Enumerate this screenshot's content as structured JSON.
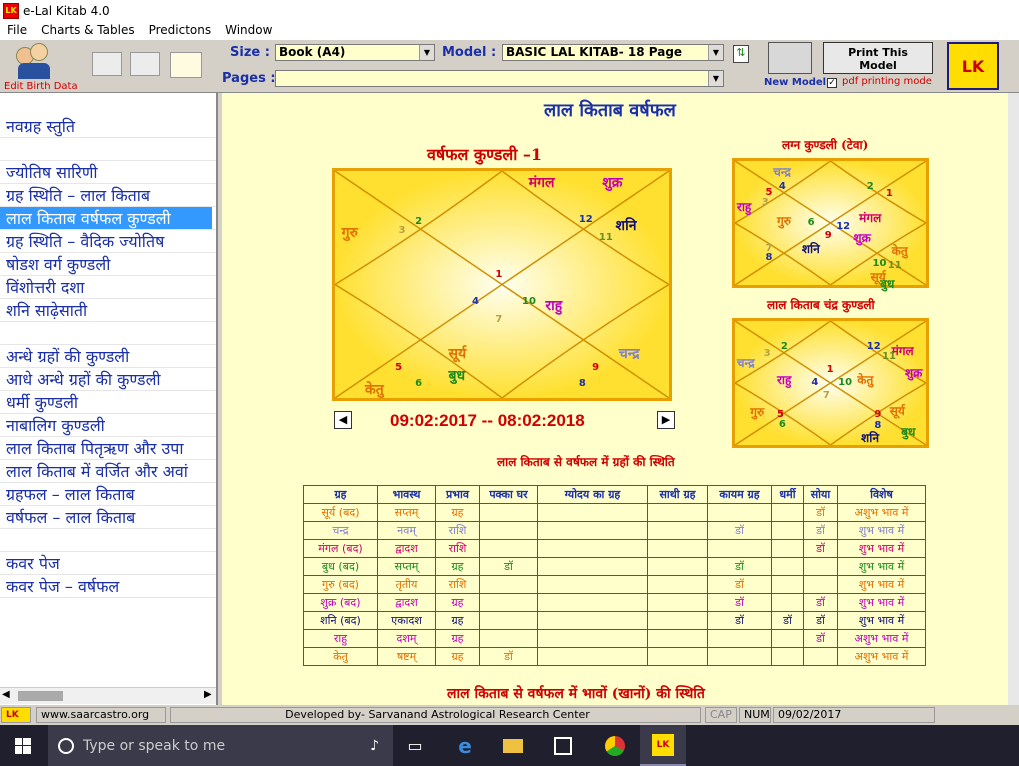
{
  "window": {
    "title": "e-Lal Kitab 4.0"
  },
  "menu": [
    "File",
    "Charts & Tables",
    "Predictons",
    "Window"
  ],
  "toolbar": {
    "edit_birth": "Edit Birth Data",
    "size_label": "Size :",
    "size_value": "Book (A4)",
    "model_label": "Model :",
    "model_value": "BASIC LAL KITAB- 18 Page",
    "pages_label": "Pages :",
    "pages_value": "",
    "new_model": "New Model",
    "print_this_1": "Print This",
    "print_this_2": "Model",
    "pdf_mode": "pdf printing mode"
  },
  "sidebar": [
    "नवग्रह स्तुति",
    "",
    "ज्योतिष सारिणी",
    "ग्रह स्थिति – लाल किताब",
    "लाल किताब वर्षफल कुण्डली",
    "ग्रह स्थिति – वैदिक ज्योतिष",
    "षोडश वर्ग कुण्डली",
    "विंशोत्तरी दशा",
    "शनि साढ़ेसाती",
    "",
    "अन्धे ग्रहों की कुण्डली",
    "आधे अन्धे ग्रहों की कुण्डली",
    "धर्मी कुण्डली",
    "नाबालिग कुण्डली",
    "लाल किताब पितृऋण और उपा",
    "लाल किताब में वर्जित और अवां",
    "ग्रहफल – लाल किताब",
    "वर्षफल – लाल किताब",
    "",
    "कवर पेज",
    "कवर पेज – वर्षफल"
  ],
  "sidebar_selected": 4,
  "main": {
    "page_title": "लाल किताब वर्षफल",
    "kundli1_title": "वर्षफल कुण्डली –1",
    "lagna_title": "लग्न कुण्डली (टेवा)",
    "chandra_title": "लाल किताब चंद्र कुण्डली",
    "date_range": "09:02:2017 -- 08:02:2018",
    "table_title": "लाल किताब से वर्षफल में ग्रहों की स्थिति",
    "bottom_title": "लाल किताब से वर्षफल में भावों (खानों) की स्थिति"
  },
  "kundli1": {
    "planets": [
      {
        "t": "मंगल",
        "c": "#d0006f"
      },
      {
        "t": "शुक्र",
        "c": "#c000c0"
      },
      {
        "t": "गुरु",
        "c": "#e07000"
      },
      {
        "t": "12",
        "c": "#1a2fa8"
      },
      {
        "t": "शनि",
        "c": "#101070"
      },
      {
        "t": "11",
        "c": "#6b8e23"
      },
      {
        "t": "2",
        "c": "#1a8a1a"
      },
      {
        "t": "3",
        "c": "#b8a040"
      },
      {
        "t": "1",
        "c": "#d00000"
      },
      {
        "t": "4",
        "c": "#1a2fa8"
      },
      {
        "t": "10",
        "c": "#1a8a1a"
      },
      {
        "t": "राहु",
        "c": "#c000c0"
      },
      {
        "t": "7",
        "c": "#b8a040"
      },
      {
        "t": "सूर्य",
        "c": "#e07000"
      },
      {
        "t": "चन्द्र",
        "c": "#8080d0"
      },
      {
        "t": "5",
        "c": "#d00000"
      },
      {
        "t": "6",
        "c": "#1a8a1a"
      },
      {
        "t": "बुध",
        "c": "#1a8a1a"
      },
      {
        "t": "9",
        "c": "#d00000"
      },
      {
        "t": "8",
        "c": "#1a2fa8"
      },
      {
        "t": "केतु",
        "c": "#e07000"
      }
    ]
  },
  "lagna": {
    "planets": [
      {
        "t": "चन्द्र",
        "c": "#8080d0"
      },
      {
        "t": "4",
        "c": "#1a2fa8"
      },
      {
        "t": "5",
        "c": "#d00000"
      },
      {
        "t": "3",
        "c": "#b8a040"
      },
      {
        "t": "राहु",
        "c": "#c000c0"
      },
      {
        "t": "2",
        "c": "#1a8a1a"
      },
      {
        "t": "1",
        "c": "#d00000"
      },
      {
        "t": "गुरु",
        "c": "#e07000"
      },
      {
        "t": "6",
        "c": "#1a8a1a"
      },
      {
        "t": "12",
        "c": "#1a2fa8"
      },
      {
        "t": "मंगल",
        "c": "#d0006f"
      },
      {
        "t": "9",
        "c": "#d00000"
      },
      {
        "t": "शुक्र",
        "c": "#c000c0"
      },
      {
        "t": "7",
        "c": "#b8a040"
      },
      {
        "t": "8",
        "c": "#1a2fa8"
      },
      {
        "t": "शनि",
        "c": "#101070"
      },
      {
        "t": "केतु",
        "c": "#e07000"
      },
      {
        "t": "10",
        "c": "#1a8a1a"
      },
      {
        "t": "11",
        "c": "#6b8e23"
      },
      {
        "t": "सूर्य",
        "c": "#e07000"
      },
      {
        "t": "बुध",
        "c": "#1a8a1a"
      }
    ]
  },
  "chandra": {
    "planets": [
      {
        "t": "2",
        "c": "#1a8a1a"
      },
      {
        "t": "12",
        "c": "#1a2fa8"
      },
      {
        "t": "3",
        "c": "#b8a040"
      },
      {
        "t": "चन्द्र",
        "c": "#8080d0"
      },
      {
        "t": "मंगल",
        "c": "#d0006f"
      },
      {
        "t": "11",
        "c": "#6b8e23"
      },
      {
        "t": "शुक्र",
        "c": "#c000c0"
      },
      {
        "t": "राहु",
        "c": "#c000c0"
      },
      {
        "t": "4",
        "c": "#1a2fa8"
      },
      {
        "t": "1",
        "c": "#d00000"
      },
      {
        "t": "10",
        "c": "#1a8a1a"
      },
      {
        "t": "केतु",
        "c": "#e07000"
      },
      {
        "t": "7",
        "c": "#b8a040"
      },
      {
        "t": "गुरु",
        "c": "#e07000"
      },
      {
        "t": "5",
        "c": "#d00000"
      },
      {
        "t": "6",
        "c": "#1a8a1a"
      },
      {
        "t": "9",
        "c": "#d00000"
      },
      {
        "t": "सूर्य",
        "c": "#e07000"
      },
      {
        "t": "8",
        "c": "#1a2fa8"
      },
      {
        "t": "शनि",
        "c": "#101070"
      },
      {
        "t": "बुध",
        "c": "#1a8a1a"
      }
    ]
  },
  "table": {
    "headers": [
      "ग्रह",
      "भावस्थ",
      "प्रभाव",
      "पक्का घर",
      "ग्योदय का ग्रह",
      "साथी ग्रह",
      "कायम ग्रह",
      "धर्मी",
      "सोया",
      "विशेष"
    ],
    "rows": [
      {
        "c": "#e07000",
        "cells": [
          "सूर्य (बद)",
          "सप्तम्",
          "ग्रह",
          "",
          "",
          "",
          "",
          "",
          "डॉ",
          "अशुभ भाव में"
        ]
      },
      {
        "c": "#8080d0",
        "cells": [
          "चन्द्र",
          "नवम्",
          "राशि",
          "",
          "",
          "",
          "डॉ",
          "",
          "डॉ",
          "शुभ भाव में"
        ]
      },
      {
        "c": "#d0006f",
        "cells": [
          "मंगल (बद)",
          "द्वादश",
          "राशि",
          "",
          "",
          "",
          "",
          "",
          "डॉ",
          "शुभ भाव में"
        ]
      },
      {
        "c": "#1a8a1a",
        "cells": [
          "बुध (बद)",
          "सप्तम्",
          "ग्रह",
          "डॉ",
          "",
          "",
          "डॉ",
          "",
          "",
          "शुभ भाव में"
        ]
      },
      {
        "c": "#e07000",
        "cells": [
          "गुरु (बद)",
          "तृतीय",
          "राशि",
          "",
          "",
          "",
          "डॉ",
          "",
          "",
          "शुभ भाव में"
        ]
      },
      {
        "c": "#c000c0",
        "cells": [
          "शुक्र (बद)",
          "द्वादश",
          "ग्रह",
          "",
          "",
          "",
          "डॉ",
          "",
          "डॉ",
          "शुभ भाव में"
        ]
      },
      {
        "c": "#101070",
        "cells": [
          "शनि (बद)",
          "एकादश",
          "ग्रह",
          "",
          "",
          "",
          "डॉ",
          "डॉ",
          "डॉ",
          "शुभ भाव में"
        ]
      },
      {
        "c": "#c000c0",
        "cells": [
          "राहु",
          "दशम्",
          "ग्रह",
          "",
          "",
          "",
          "",
          "",
          "डॉ",
          "अशुभ भाव में"
        ]
      },
      {
        "c": "#e07000",
        "cells": [
          "केतु",
          "षष्टम्",
          "ग्रह",
          "डॉ",
          "",
          "",
          "",
          "",
          "",
          "अशुभ भाव में"
        ]
      }
    ]
  },
  "status": {
    "url": "www.saarcastro.org",
    "dev": "Developed by- Sarvanand Astrological Research Center",
    "cap": "CAP",
    "num": "NUM",
    "date": "09/02/2017"
  },
  "taskbar": {
    "search": "Type or speak to me"
  },
  "colors": {
    "accent": "#1a2fa8",
    "heading": "#d00000",
    "panel": "#ffffcc",
    "select": "#3399ff"
  }
}
